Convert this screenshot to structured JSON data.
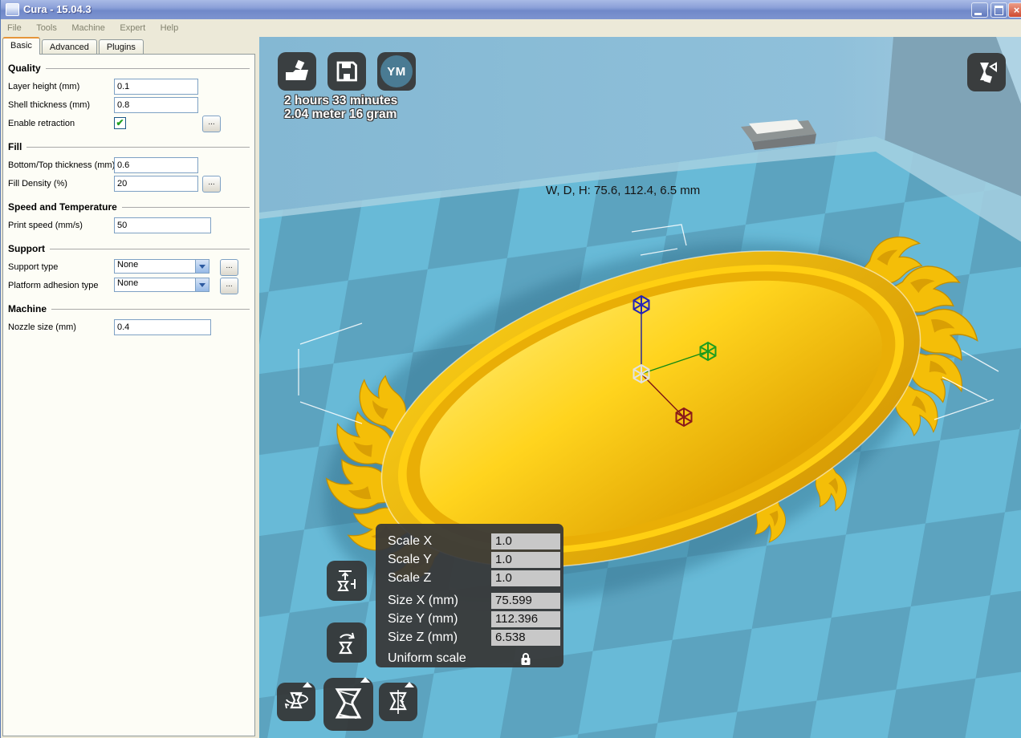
{
  "window": {
    "title": "Cura - 15.04.3"
  },
  "menubar": {
    "items": [
      "File",
      "Tools",
      "Machine",
      "Expert",
      "Help"
    ]
  },
  "sidebar": {
    "tabs": [
      {
        "label": "Basic"
      },
      {
        "label": "Advanced"
      },
      {
        "label": "Plugins"
      }
    ],
    "sections": [
      {
        "title": "Quality",
        "rows": [
          {
            "label": "Layer height (mm)",
            "value": "0.1"
          },
          {
            "label": "Shell thickness (mm)",
            "value": "0.8"
          },
          {
            "label": "Enable retraction",
            "checked": true
          }
        ]
      },
      {
        "title": "Fill",
        "rows": [
          {
            "label": "Bottom/Top thickness (mm)",
            "value": "0.6"
          },
          {
            "label": "Fill Density (%)",
            "value": "20"
          }
        ]
      },
      {
        "title": "Speed and Temperature",
        "rows": [
          {
            "label": "Print speed (mm/s)",
            "value": "50"
          }
        ]
      },
      {
        "title": "Support",
        "rows": [
          {
            "label": "Support type",
            "value": "None"
          },
          {
            "label": "Platform adhesion type",
            "value": "None"
          }
        ]
      },
      {
        "title": "Machine",
        "rows": [
          {
            "label": "Nozzle size (mm)",
            "value": "0.4"
          }
        ]
      }
    ]
  },
  "viewport": {
    "stats": {
      "print_time": "2 hours 33 minutes",
      "material_usage": "2.04 meter 16 gram"
    },
    "model_info": "W, D, H: 75.6, 112.4, 6.5 mm",
    "toolbar": {
      "ym_label": "YM"
    },
    "scale_panel": {
      "rows": [
        {
          "label": "Scale X",
          "value": "1.0"
        },
        {
          "label": "Scale Y",
          "value": "1.0"
        },
        {
          "label": "Scale Z",
          "value": "1.0"
        },
        {
          "label": "Size X (mm)",
          "value": "75.599"
        },
        {
          "label": "Size Y (mm)",
          "value": "112.396"
        },
        {
          "label": "Size Z (mm)",
          "value": "6.538"
        }
      ],
      "uniform_label": "Uniform scale"
    }
  },
  "icons": {
    "check": "✔",
    "more": "...",
    "close": "×"
  },
  "colors": {
    "plate_light": "#68BAD7",
    "plate_dark": "#5CA3BF",
    "wall": "#87BBD5",
    "wall_right": "#7FA3B6",
    "model_gold": "#FFD01E",
    "panel_bg": "#ECE9D8",
    "button_dark": "#343434",
    "titlebar_blue": "#7D94D0",
    "axis_x": "#8B1A1A",
    "axis_y": "#1E9E1E",
    "axis_z": "#2525B5"
  }
}
